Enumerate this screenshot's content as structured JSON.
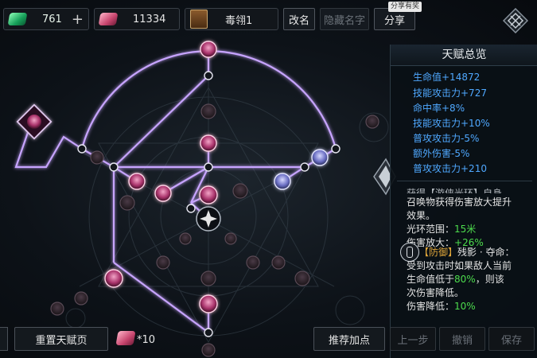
{
  "currency": {
    "green_amount": "761",
    "plus_label": "+",
    "red_amount": "11334"
  },
  "page": {
    "name": "毒翎1"
  },
  "buttons": {
    "rename": "改名",
    "hide_name": "隐藏名字",
    "share": "分享",
    "share_badge": "分享有奖"
  },
  "panel": {
    "title": "天赋总览",
    "stats": [
      "生命值+14872",
      "技能攻击力+727",
      "命中率+8%",
      "技能攻击力+10%",
      "普攻攻击力-5%",
      "额外伤害-5%",
      "普攻攻击力+210"
    ],
    "aura": {
      "partial": "获得【游侠光环】自身",
      "line1": "召唤物获得伤害放大提升",
      "line2": "效果。",
      "range_label": "光环范围：",
      "range_value": "15米",
      "amp_label": "伤害放大：",
      "amp_value": "+26%"
    },
    "defense": {
      "tag": "【防御】",
      "name": "残影 · 夺命：",
      "line1": "受到攻击时如果敌人当前",
      "line2a": "生命值低于",
      "line2b": "80%",
      "line2c": "，则该",
      "line3": "次伤害降低。",
      "reduce_label": "伤害降低：",
      "reduce_value": "10%"
    }
  },
  "bottom": {
    "reset": "重置天赋页",
    "gem_count": "*10",
    "recommend": "推荐加点",
    "prev": "上一步",
    "undo": "撤销",
    "save": "保存"
  },
  "colors": {
    "accent_blue": "#4fa8ff",
    "green": "#4ddc4d",
    "gold": "#e1a73a",
    "link_purple": "#c7a4ff"
  }
}
